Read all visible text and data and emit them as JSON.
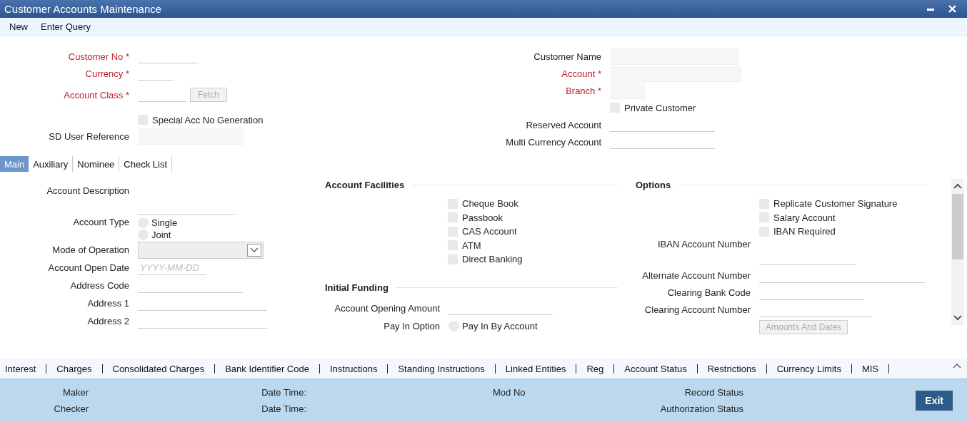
{
  "window": {
    "title": "Customer Accounts Maintenance"
  },
  "toolbar": [
    "New",
    "Enter Query"
  ],
  "header": {
    "left": [
      {
        "kind": "input",
        "label": "Customer No *",
        "required": true
      },
      {
        "kind": "input",
        "label": "Currency *",
        "required": true
      },
      {
        "kind": "input",
        "label": "Account Class *",
        "required": true,
        "button": "Fetch"
      },
      {
        "kind": "checkbox",
        "label": "Special Acc No Generation",
        "checked": false
      },
      {
        "kind": "filled",
        "label": "SD User Reference",
        "required": false
      }
    ],
    "right": [
      {
        "kind": "filled",
        "label": "Customer Name",
        "required": false
      },
      {
        "kind": "filled",
        "label": "Account *",
        "required": true
      },
      {
        "kind": "filled",
        "label": "Branch *",
        "required": true
      },
      {
        "kind": "checkbox",
        "label": "Private Customer",
        "checked": false
      },
      {
        "kind": "input",
        "label": "Reserved Account",
        "required": false
      },
      {
        "kind": "input",
        "label": "Multi Currency Account",
        "required": false
      }
    ]
  },
  "tabs": [
    {
      "label": "Main",
      "selected": true
    },
    {
      "label": "Auxiliary",
      "selected": false
    },
    {
      "label": "Nominee",
      "selected": false
    },
    {
      "label": "Check List",
      "selected": false
    }
  ],
  "main": {
    "left": [
      {
        "kind": "input-below",
        "label": "Account Description"
      },
      {
        "kind": "radio",
        "label": "Account Type",
        "options": [
          {
            "label": "Single",
            "selected": false
          },
          {
            "label": "Joint",
            "selected": false
          }
        ]
      },
      {
        "kind": "select",
        "label": "Mode of Operation"
      },
      {
        "kind": "input",
        "label": "Account Open Date",
        "placeholder": "YYYY-MM-DD"
      },
      {
        "kind": "input",
        "label": "Address Code"
      },
      {
        "kind": "input",
        "label": "Address 1"
      },
      {
        "kind": "input",
        "label": "Address 2"
      }
    ],
    "facilities": {
      "title": "Account Facilities",
      "items": [
        {
          "label": "Cheque Book",
          "checked": false
        },
        {
          "label": "Passbook",
          "checked": false
        },
        {
          "label": "CAS Account",
          "checked": false
        },
        {
          "label": "ATM",
          "checked": false
        },
        {
          "label": "Direct Banking",
          "checked": false
        }
      ]
    },
    "funding": {
      "title": "Initial Funding",
      "rows": [
        {
          "kind": "input",
          "label": "Account Opening Amount"
        },
        {
          "kind": "radio",
          "label": "Pay In Option",
          "options": [
            {
              "label": "Pay In By Account",
              "selected": false
            }
          ]
        }
      ]
    },
    "options": {
      "title": "Options",
      "items": [
        {
          "label": "Replicate Customer Signature",
          "checked": false
        },
        {
          "label": "Salary Account",
          "checked": false
        },
        {
          "label": "IBAN Required",
          "checked": false
        }
      ],
      "rows": [
        {
          "kind": "input-below",
          "label": "IBAN Account Number"
        },
        {
          "kind": "input",
          "label": "Alternate Account Number"
        },
        {
          "kind": "input",
          "label": "Clearing Bank Code"
        },
        {
          "kind": "input",
          "label": "Clearing Account Number"
        },
        {
          "kind": "button",
          "label": "Amounts And Dates"
        }
      ]
    }
  },
  "links": [
    "Interest",
    "Charges",
    "Consolidated Charges",
    "Bank Identifier Code",
    "Instructions",
    "Standing Instructions",
    "Linked Entities",
    "Reg",
    "Account Status",
    "Restrictions",
    "Currency Limits",
    "MIS"
  ],
  "footer": {
    "rows": [
      [
        "Maker",
        "Date Time:",
        "Mod No",
        "Record Status"
      ],
      [
        "Checker",
        "Date Time:",
        "",
        "Authorization Status"
      ]
    ],
    "exit": "Exit"
  }
}
